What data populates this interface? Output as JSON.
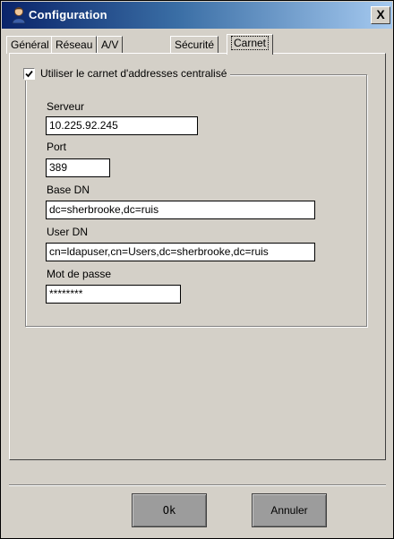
{
  "window": {
    "title": "Configuration",
    "close_label": "X"
  },
  "tabs": [
    {
      "label": "Général",
      "active": false
    },
    {
      "label": "Réseau",
      "active": false
    },
    {
      "label": "A/V",
      "active": false
    },
    {
      "label": "Sécurité",
      "active": false
    },
    {
      "label": "Carnet",
      "active": true
    }
  ],
  "group": {
    "checkbox_label": "Utiliser le carnet d'addresses centralisé",
    "checked": true
  },
  "fields": {
    "server": {
      "label": "Serveur",
      "value": "10.225.92.245"
    },
    "port": {
      "label": "Port",
      "value": "389"
    },
    "base_dn": {
      "label": "Base DN",
      "value": "dc=sherbrooke,dc=ruis"
    },
    "user_dn": {
      "label": "User DN",
      "value": "cn=ldapuser,cn=Users,dc=sherbrooke,dc=ruis"
    },
    "password": {
      "label": "Mot de passe",
      "value": "********"
    }
  },
  "buttons": {
    "ok_label": "Ok",
    "cancel_label": "Annuler"
  },
  "colors": {
    "title_gradient_start": "#0a246a",
    "title_gradient_end": "#a6caf0",
    "window_bg": "#d4d0c8",
    "button_bg": "#9c9c9c"
  },
  "icons": {
    "title": "user-icon",
    "close": "close-icon",
    "checkbox": "checkmark-icon"
  }
}
